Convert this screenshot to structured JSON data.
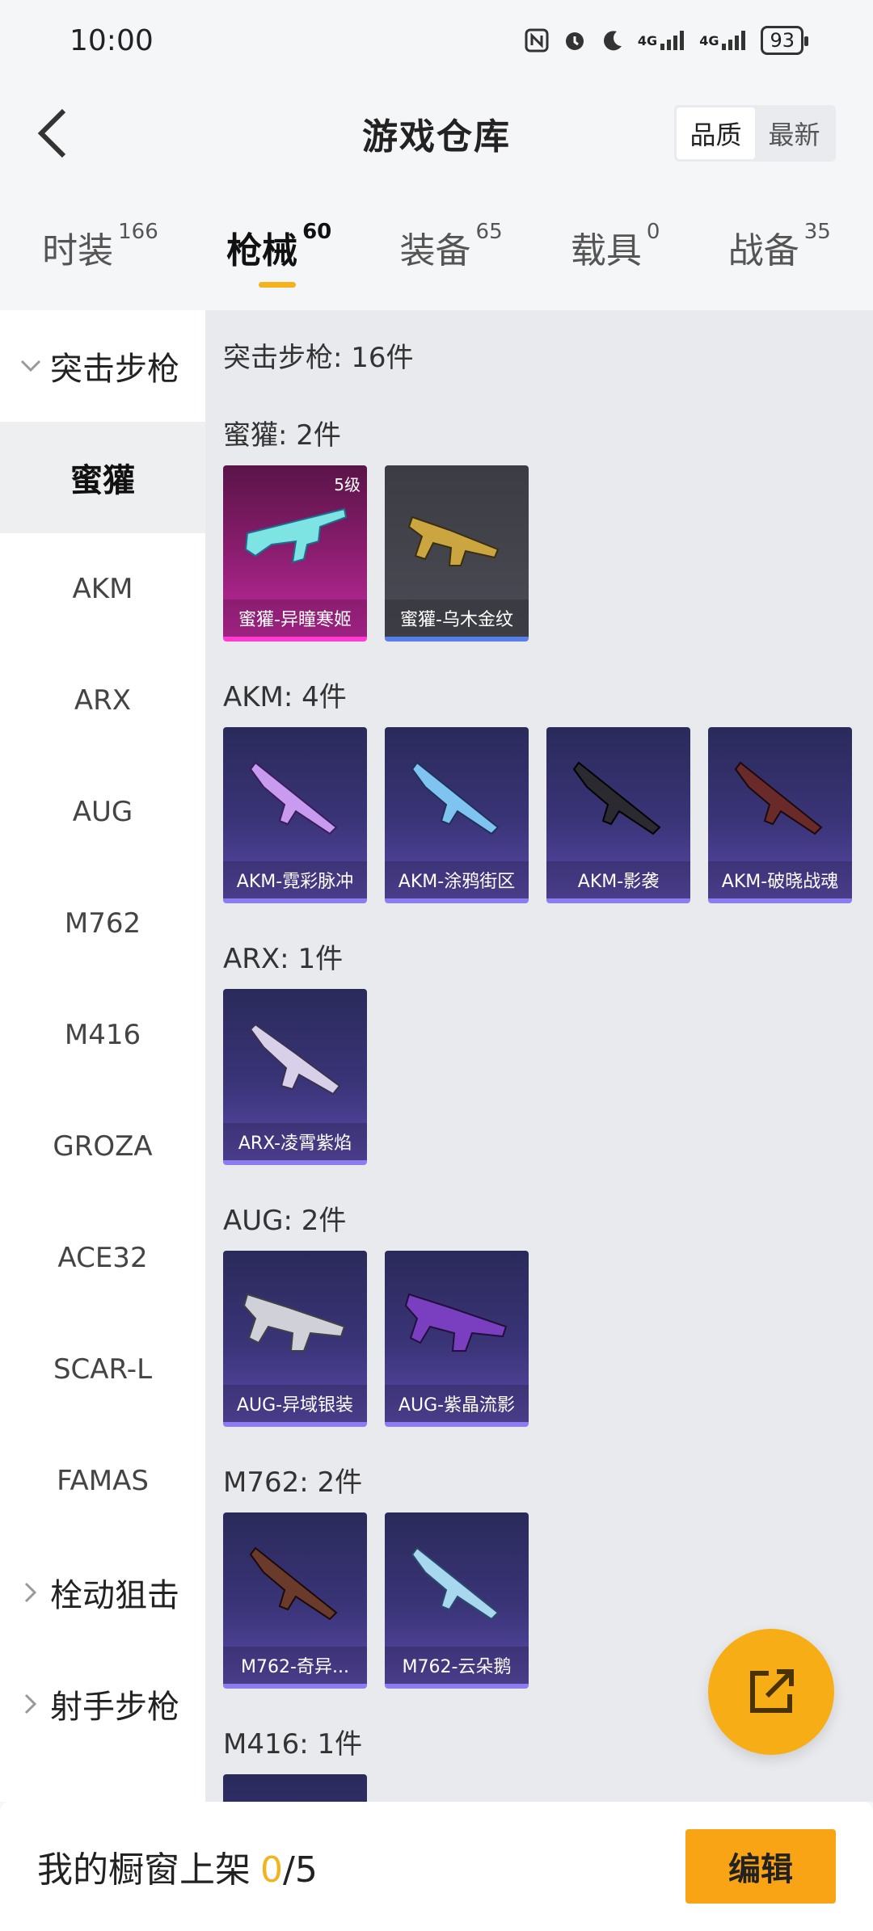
{
  "status_bar": {
    "time": "10:00",
    "signal1": "4G",
    "signal2": "4G",
    "battery": "93"
  },
  "header": {
    "title": "游戏仓库",
    "sort": {
      "quality": "品质",
      "latest": "最新"
    }
  },
  "tabs": [
    {
      "label": "时装",
      "count": "166"
    },
    {
      "label": "枪械",
      "count": "60"
    },
    {
      "label": "装备",
      "count": "65"
    },
    {
      "label": "载具",
      "count": "0"
    },
    {
      "label": "战备",
      "count": "35"
    }
  ],
  "sidebar": {
    "group_expanded": "突击步枪",
    "items": [
      "蜜獾",
      "AKM",
      "ARX",
      "AUG",
      "M762",
      "M416",
      "GROZA",
      "ACE32",
      "SCAR-L",
      "FAMAS"
    ],
    "group2": "栓动狙击",
    "group3": "射手步枪"
  },
  "content": {
    "summary": "突击步枪: 16件",
    "sections": [
      {
        "title": "蜜獾: 2件",
        "items": [
          {
            "name": "蜜獾-异瞳寒姬",
            "level": "5级"
          },
          {
            "name": "蜜獾-乌木金纹"
          }
        ]
      },
      {
        "title": "AKM: 4件",
        "items": [
          {
            "name": "AKM-霓彩脉冲"
          },
          {
            "name": "AKM-涂鸦街区"
          },
          {
            "name": "AKM-影袭"
          },
          {
            "name": "AKM-破晓战魂"
          }
        ]
      },
      {
        "title": "ARX: 1件",
        "items": [
          {
            "name": "ARX-凌霄紫焰"
          }
        ]
      },
      {
        "title": "AUG: 2件",
        "items": [
          {
            "name": "AUG-异域银装"
          },
          {
            "name": "AUG-紫晶流影"
          }
        ]
      },
      {
        "title": "M762: 2件",
        "items": [
          {
            "name": "M762-奇异..."
          },
          {
            "name": "M762-云朵鹅"
          }
        ]
      },
      {
        "title": "M416: 1件",
        "items": []
      }
    ]
  },
  "bottom_bar": {
    "label": "我的橱窗上架",
    "used": "0",
    "total": "/5",
    "edit": "编辑"
  },
  "colors": {
    "accent": "#f5b21a",
    "button": "#f8a414"
  }
}
